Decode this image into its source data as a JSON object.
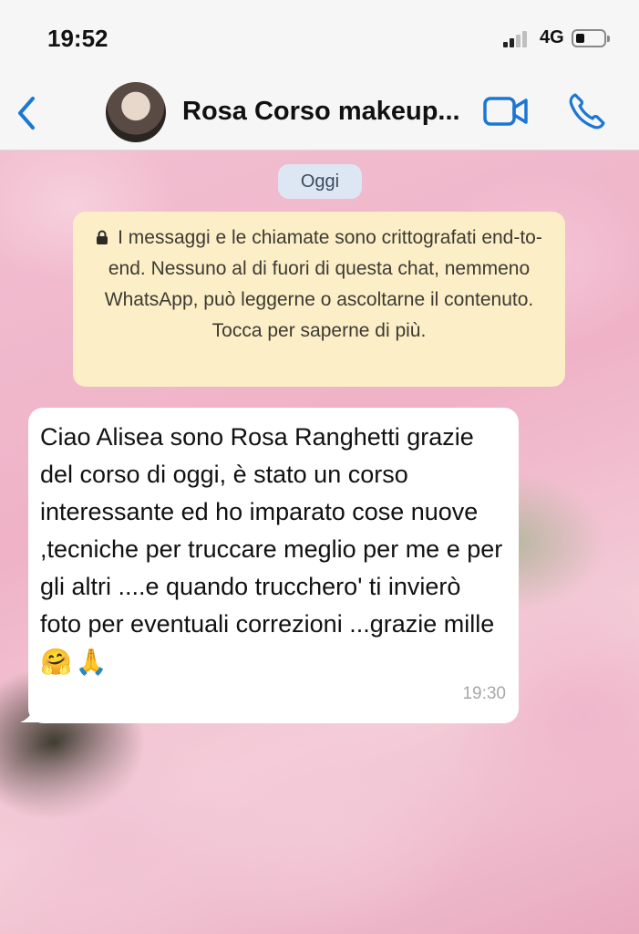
{
  "status_bar": {
    "time": "19:52",
    "network": "4G",
    "signal_bars_active": 2,
    "battery_level": 0.25
  },
  "header": {
    "back_icon": "chevron-left-icon",
    "contact_name": "Rosa Corso makeup...",
    "video_icon": "video-camera-icon",
    "call_icon": "phone-icon",
    "accent": "#1b77d2"
  },
  "chat": {
    "date_label": "Oggi",
    "encryption_notice": "I messaggi e le chiamate sono crittografati end-to-end. Nessuno al di fuori di questa chat, nemmeno WhatsApp, può leggerne o ascoltarne il contenuto. Tocca per saperne di più.",
    "messages": [
      {
        "text": "Ciao Alisea sono Rosa Ranghetti grazie del corso di oggi, è stato un corso interessante ed ho imparato cose nuove ,tecniche per truccare meglio per me e per gli altri ....e quando truccherο' ti invierò foto per eventuali correzioni ...grazie mille",
        "emojis": "🤗🙏",
        "time": "19:30"
      }
    ]
  }
}
